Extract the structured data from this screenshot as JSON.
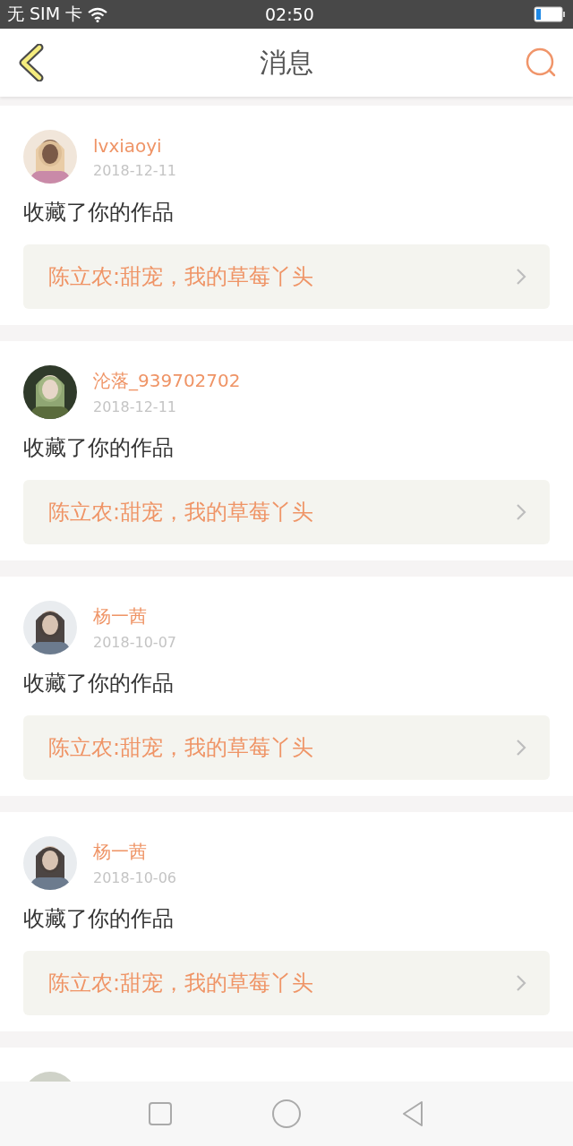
{
  "status_bar": {
    "carrier": "无 SIM 卡",
    "time": "02:50"
  },
  "header": {
    "title": "消息"
  },
  "messages": [
    {
      "kind": "full",
      "user": "lvxiaoyi",
      "date": "2018-12-11",
      "action": "收藏了你的作品",
      "work": "陈立农:甜宠，我的草莓丫头"
    },
    {
      "kind": "full",
      "user": "沦落_939702702",
      "date": "2018-12-11",
      "action": "收藏了你的作品",
      "work": "陈立农:甜宠，我的草莓丫头"
    },
    {
      "kind": "full",
      "user": "杨一茜",
      "date": "2018-10-07",
      "action": "收藏了你的作品",
      "work": "陈立农:甜宠，我的草莓丫头"
    },
    {
      "kind": "full",
      "user": "杨一茜",
      "date": "2018-10-06",
      "action": "收藏了你的作品",
      "work": "陈立农:甜宠，我的草莓丫头"
    },
    {
      "kind": "partial"
    }
  ]
}
